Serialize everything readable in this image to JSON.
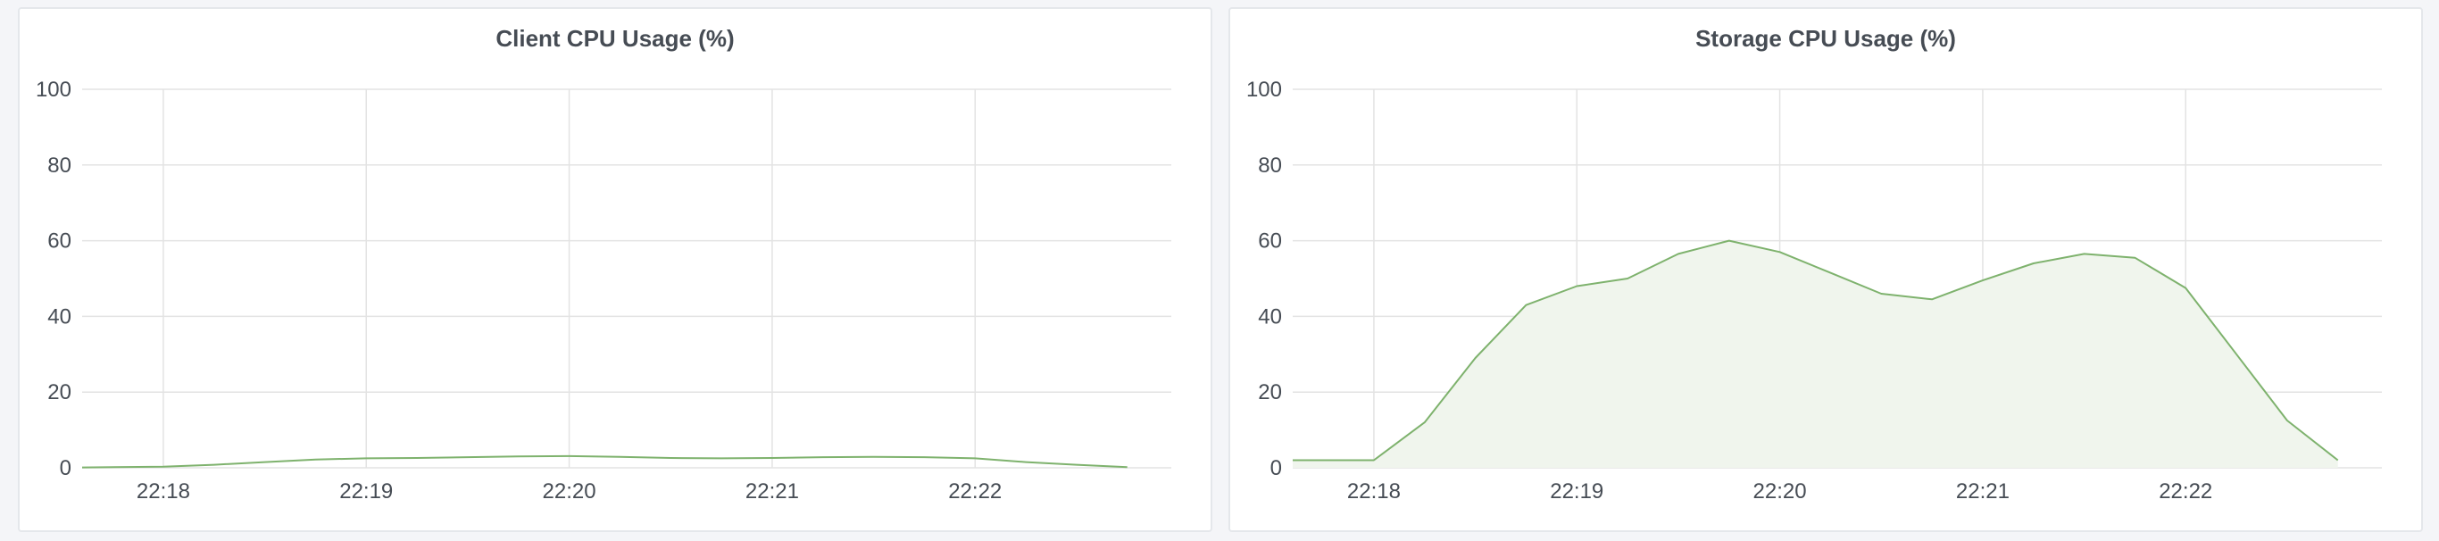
{
  "chart_data": [
    {
      "type": "area",
      "title": "Client CPU Usage (%)",
      "xlabel": "",
      "ylabel": "",
      "ylim": [
        0,
        100
      ],
      "yticks": [
        0,
        20,
        40,
        60,
        80,
        100
      ],
      "xlim": [
        "22:17:36",
        "22:22:58"
      ],
      "xticks": [
        "22:18",
        "22:19",
        "22:20",
        "22:21",
        "22:22"
      ],
      "grid": true,
      "line_color": "#7eb26d",
      "fill": false,
      "series": [
        {
          "x": [
            "22:17:36",
            "22:18:00",
            "22:18:15",
            "22:18:30",
            "22:18:45",
            "22:19:00",
            "22:19:15",
            "22:19:30",
            "22:19:45",
            "22:20:00",
            "22:20:15",
            "22:20:30",
            "22:20:45",
            "22:21:00",
            "22:21:15",
            "22:21:30",
            "22:21:45",
            "22:22:00",
            "22:22:15",
            "22:22:30",
            "22:22:45"
          ],
          "values": [
            0.1,
            0.3,
            0.8,
            1.5,
            2.2,
            2.5,
            2.6,
            2.8,
            3.0,
            3.1,
            2.9,
            2.6,
            2.5,
            2.6,
            2.8,
            2.9,
            2.8,
            2.5,
            1.5,
            0.8,
            0.2
          ]
        }
      ]
    },
    {
      "type": "area",
      "title": "Storage CPU Usage (%)",
      "xlabel": "",
      "ylabel": "",
      "ylim": [
        0,
        100
      ],
      "yticks": [
        0,
        20,
        40,
        60,
        80,
        100
      ],
      "xlim": [
        "22:17:36",
        "22:22:58"
      ],
      "xticks": [
        "22:18",
        "22:19",
        "22:20",
        "22:21",
        "22:22"
      ],
      "grid": true,
      "line_color": "#7eb26d",
      "fill_color": "#f0f5ed",
      "fill": true,
      "series": [
        {
          "x": [
            "22:17:36",
            "22:18:00",
            "22:18:15",
            "22:18:30",
            "22:18:45",
            "22:19:00",
            "22:19:15",
            "22:19:30",
            "22:19:45",
            "22:20:00",
            "22:20:15",
            "22:20:30",
            "22:20:45",
            "22:21:00",
            "22:21:15",
            "22:21:30",
            "22:21:45",
            "22:22:00",
            "22:22:15",
            "22:22:30",
            "22:22:45"
          ],
          "values": [
            2,
            2,
            12,
            29,
            43,
            48,
            50,
            56.5,
            60,
            57,
            51.5,
            46,
            44.5,
            49.5,
            54,
            56.5,
            55.5,
            47.5,
            30,
            12.5,
            2
          ]
        }
      ]
    }
  ]
}
